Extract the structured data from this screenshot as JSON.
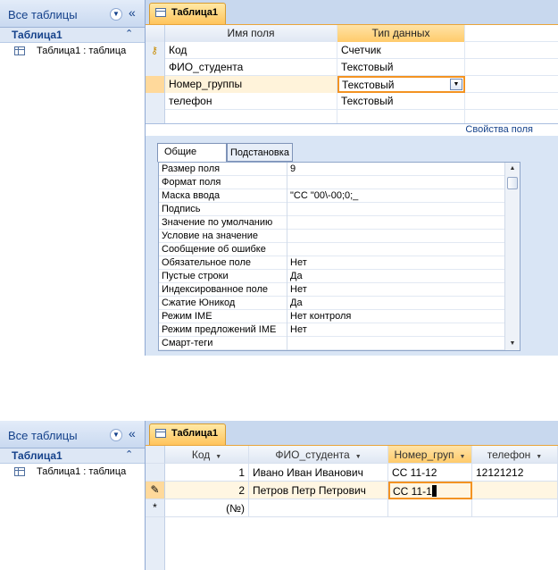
{
  "nav": {
    "title": "Все таблицы",
    "dropdown_icon": "chevron-down-icon",
    "collapse_icon": "double-chevron-left-icon",
    "group": "Таблица1",
    "group_toggle_icon": "double-chevron-up-icon",
    "item": "Таблица1 : таблица",
    "item_icon": "table-icon"
  },
  "tab": {
    "label": "Таблица1",
    "icon": "table-icon"
  },
  "design": {
    "header": {
      "name": "Имя поля",
      "type": "Тип данных"
    },
    "rows": [
      {
        "name": "Код",
        "type": "Счетчик",
        "key": true
      },
      {
        "name": "ФИО_студента",
        "type": "Текстовый"
      },
      {
        "name": "Номер_группы",
        "type": "Текстовый",
        "current": true
      },
      {
        "name": "телефон",
        "type": "Текстовый"
      }
    ],
    "props_title": "Свойства поля",
    "tabs": [
      "Общие",
      "Подстановка"
    ],
    "properties": [
      {
        "name": "Размер поля",
        "value": "9"
      },
      {
        "name": "Формат поля",
        "value": ""
      },
      {
        "name": "Маска ввода",
        "value": "\"СС \"00\\-00;0;_"
      },
      {
        "name": "Подпись",
        "value": ""
      },
      {
        "name": "Значение по умолчанию",
        "value": ""
      },
      {
        "name": "Условие на значение",
        "value": ""
      },
      {
        "name": "Сообщение об ошибке",
        "value": ""
      },
      {
        "name": "Обязательное поле",
        "value": "Нет"
      },
      {
        "name": "Пустые строки",
        "value": "Да"
      },
      {
        "name": "Индексированное поле",
        "value": "Нет"
      },
      {
        "name": "Сжатие Юникод",
        "value": "Да"
      },
      {
        "name": "Режим IME",
        "value": "Нет контроля"
      },
      {
        "name": "Режим предложений IME",
        "value": "Нет"
      },
      {
        "name": "Смарт-теги",
        "value": ""
      }
    ]
  },
  "datasheet": {
    "headers": [
      "Код",
      "ФИО_студента",
      "Номер_груп",
      "телефон"
    ],
    "rows": [
      {
        "kod": "1",
        "fio": "Ивано Иван Иванович",
        "grp": "СС 11-12",
        "tel": "12121212"
      },
      {
        "kod": "2",
        "fio": "Петров Петр Петрович",
        "grp": "СС 11-1",
        "tel": ""
      }
    ],
    "new_row_kod": "(№)",
    "edit_icon": "pencil-icon",
    "new_row_marker": "*"
  }
}
